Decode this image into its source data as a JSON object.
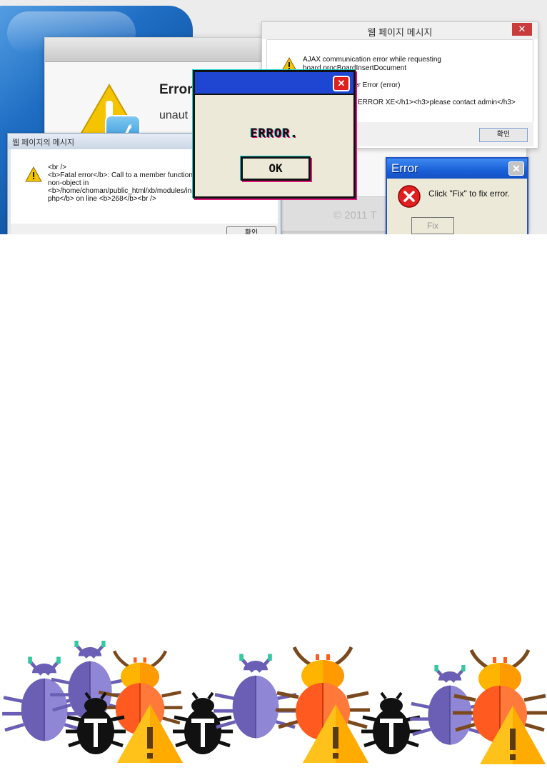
{
  "collage": {
    "mac_dialog": {
      "title": "Error",
      "subtitle": "unaut",
      "copyright": "© 2011 T"
    },
    "ajax_window": {
      "title": "웹 페이지 메시지",
      "close_glyph": "✕",
      "lines": [
        "AJAX communication error while requesting",
        "board.procBoardInsertDocument",
        "er Error (error)",
        "l ERROR XE</h1><h3>please contact admin</h3>"
      ],
      "ok_label": "확인"
    },
    "php_window": {
      "title": "웹 페이지의 메시지",
      "lines": [
        "<br />",
        "<b>Fatal error</b>:  Call to a member function",
        "non-object in",
        "<b>/home/choman/public_html/xb/modules/ins",
        "php</b> on line <b>268</b><br />"
      ],
      "ok_label": "확인"
    },
    "retro_window": {
      "message": "ERROR.",
      "ok_label": "OK",
      "close_glyph": "✕"
    },
    "xp_window": {
      "title": "Error",
      "message": "Click \"Fix\" to fix error.",
      "fix_label": "Fix",
      "close_glyph": "✕"
    }
  },
  "colors": {
    "bug_purple": "#6a5fb5",
    "bug_purple_light": "#8f86d6",
    "bug_orange": "#ff5a1f",
    "bug_yellow": "#ffb400",
    "bug_black": "#111111",
    "warning_yellow": "#ffc21a",
    "antenna_teal": "#33c8a0",
    "leg_brown": "#7a4a1e"
  },
  "icons": [
    "warning-icon",
    "error-x-icon",
    "close-icon",
    "twitter-bird-icon",
    "bug-icon"
  ]
}
